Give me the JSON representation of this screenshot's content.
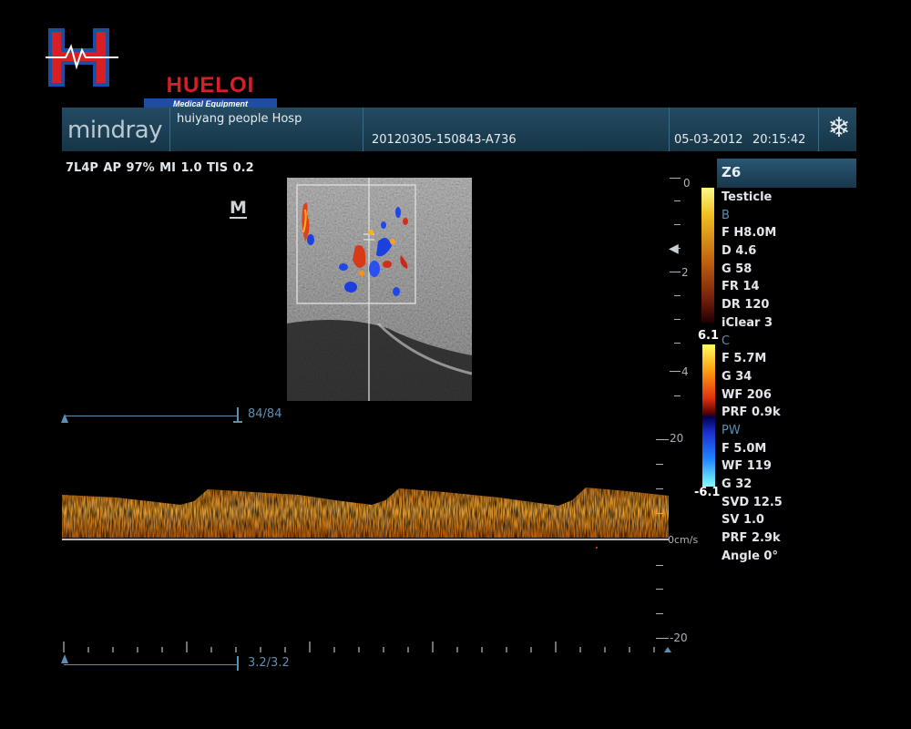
{
  "logo": {
    "name": "HUELOI",
    "subtitle": "Medical Equipment"
  },
  "header": {
    "brand": "mindray",
    "hospital": "huiyang people Hosp",
    "exam_id": "20120305-150843-A736",
    "date": "05-03-2012",
    "time": "20:15:42",
    "freeze_icon": "snowflake-icon"
  },
  "probe_info": "7L4P  AP 97%  MI 1.0 TIS 0.2",
  "marker": "M",
  "preset": "Z6",
  "params": [
    {
      "text": "Testicle",
      "section": false
    },
    {
      "text": "B",
      "section": true
    },
    {
      "text": "F H8.0M",
      "section": false
    },
    {
      "text": "D 4.6",
      "section": false
    },
    {
      "text": "G 58",
      "section": false
    },
    {
      "text": "FR 14",
      "section": false
    },
    {
      "text": "DR 120",
      "section": false
    },
    {
      "text": "iClear 3",
      "section": false
    },
    {
      "text": "C",
      "section": true
    },
    {
      "text": "F 5.7M",
      "section": false
    },
    {
      "text": "G 34",
      "section": false
    },
    {
      "text": "WF 206",
      "section": false
    },
    {
      "text": "PRF 0.9k",
      "section": false
    },
    {
      "text": "PW",
      "section": true
    },
    {
      "text": "F 5.0M",
      "section": false
    },
    {
      "text": "WF 119",
      "section": false
    },
    {
      "text": "G 32",
      "section": false
    },
    {
      "text": "SVD 12.5",
      "section": false
    },
    {
      "text": "SV 1.0",
      "section": false
    },
    {
      "text": "PRF 2.9k",
      "section": false
    },
    {
      "text": "Angle 0°",
      "section": false
    }
  ],
  "color_scale": {
    "top": "6.1",
    "bottom": "-6.1"
  },
  "depth_scale": {
    "labels": [
      "0",
      "2",
      "4"
    ]
  },
  "velocity_scale": {
    "top": "20",
    "zero": "0cm/s",
    "bottom": "-20"
  },
  "cine_counter": "84/84",
  "sweep_counter": "3.2/3.2",
  "colors": {
    "header_bg": "#1d4258",
    "accent_blue": "#5d8fb0",
    "spectrum": "#e8a020"
  }
}
